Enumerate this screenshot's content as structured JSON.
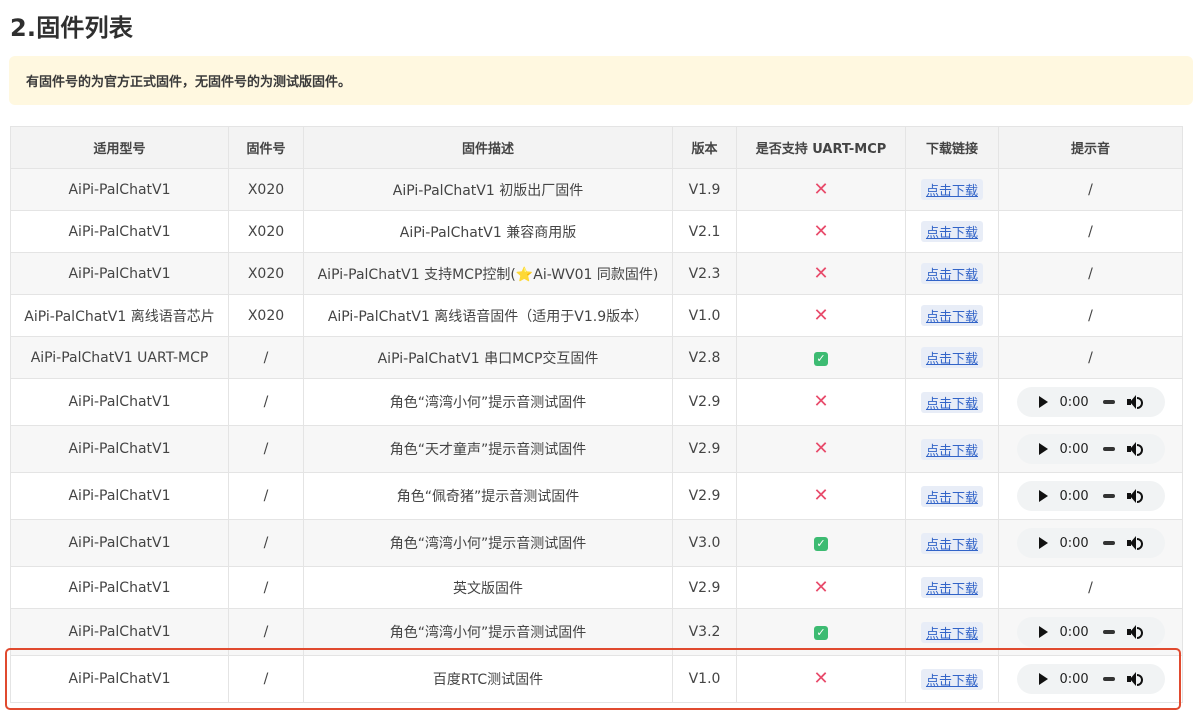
{
  "section_title": "2.固件列表",
  "notice": "有固件号的为官方正式固件，无固件号的为测试版固件。",
  "columns": [
    "适用型号",
    "固件号",
    "固件描述",
    "版本",
    "是否支持 UART-MCP",
    "下载链接",
    "提示音"
  ],
  "download_label": "点击下载",
  "audio_time": "0:00",
  "rows": [
    {
      "model": "AiPi-PalChatV1",
      "fw": "X020",
      "desc": "AiPi-PalChatV1 初版出厂固件",
      "ver": "V1.9",
      "mcp": "no",
      "tone": "/"
    },
    {
      "model": "AiPi-PalChatV1",
      "fw": "X020",
      "desc": "AiPi-PalChatV1 兼容商用版",
      "ver": "V2.1",
      "mcp": "no",
      "tone": "/"
    },
    {
      "model": "AiPi-PalChatV1",
      "fw": "X020",
      "desc": "AiPi-PalChatV1 支持MCP控制(⭐Ai-WV01 同款固件)",
      "ver": "V2.3",
      "mcp": "no",
      "tone": "/"
    },
    {
      "model": "AiPi-PalChatV1 离线语音芯片",
      "fw": "X020",
      "desc": "AiPi-PalChatV1 离线语音固件（适用于V1.9版本）",
      "ver": "V1.0",
      "mcp": "no",
      "tone": "/"
    },
    {
      "model": "AiPi-PalChatV1 UART-MCP",
      "fw": "/",
      "desc": "AiPi-PalChatV1 串口MCP交互固件",
      "ver": "V2.8",
      "mcp": "yes",
      "tone": "/"
    },
    {
      "model": "AiPi-PalChatV1",
      "fw": "/",
      "desc": "角色“湾湾小何”提示音测试固件",
      "ver": "V2.9",
      "mcp": "no",
      "tone": "audio"
    },
    {
      "model": "AiPi-PalChatV1",
      "fw": "/",
      "desc": "角色“天才童声”提示音测试固件",
      "ver": "V2.9",
      "mcp": "no",
      "tone": "audio"
    },
    {
      "model": "AiPi-PalChatV1",
      "fw": "/",
      "desc": "角色“佩奇猪”提示音测试固件",
      "ver": "V2.9",
      "mcp": "no",
      "tone": "audio"
    },
    {
      "model": "AiPi-PalChatV1",
      "fw": "/",
      "desc": "角色“湾湾小何”提示音测试固件",
      "ver": "V3.0",
      "mcp": "yes",
      "tone": "audio"
    },
    {
      "model": "AiPi-PalChatV1",
      "fw": "/",
      "desc": "英文版固件",
      "ver": "V2.9",
      "mcp": "no",
      "tone": "/"
    },
    {
      "model": "AiPi-PalChatV1",
      "fw": "/",
      "desc": "角色“湾湾小何”提示音测试固件",
      "ver": "V3.2",
      "mcp": "yes",
      "tone": "audio"
    },
    {
      "model": "AiPi-PalChatV1",
      "fw": "/",
      "desc": "百度RTC测试固件",
      "ver": "V1.0",
      "mcp": "no",
      "tone": "audio"
    }
  ],
  "colors": {
    "accent_link": "#3264c8",
    "cross": "#e84a6a",
    "check": "#3dbb72",
    "highlight": "#e04a2f",
    "notice_bg": "#fff8e0"
  }
}
